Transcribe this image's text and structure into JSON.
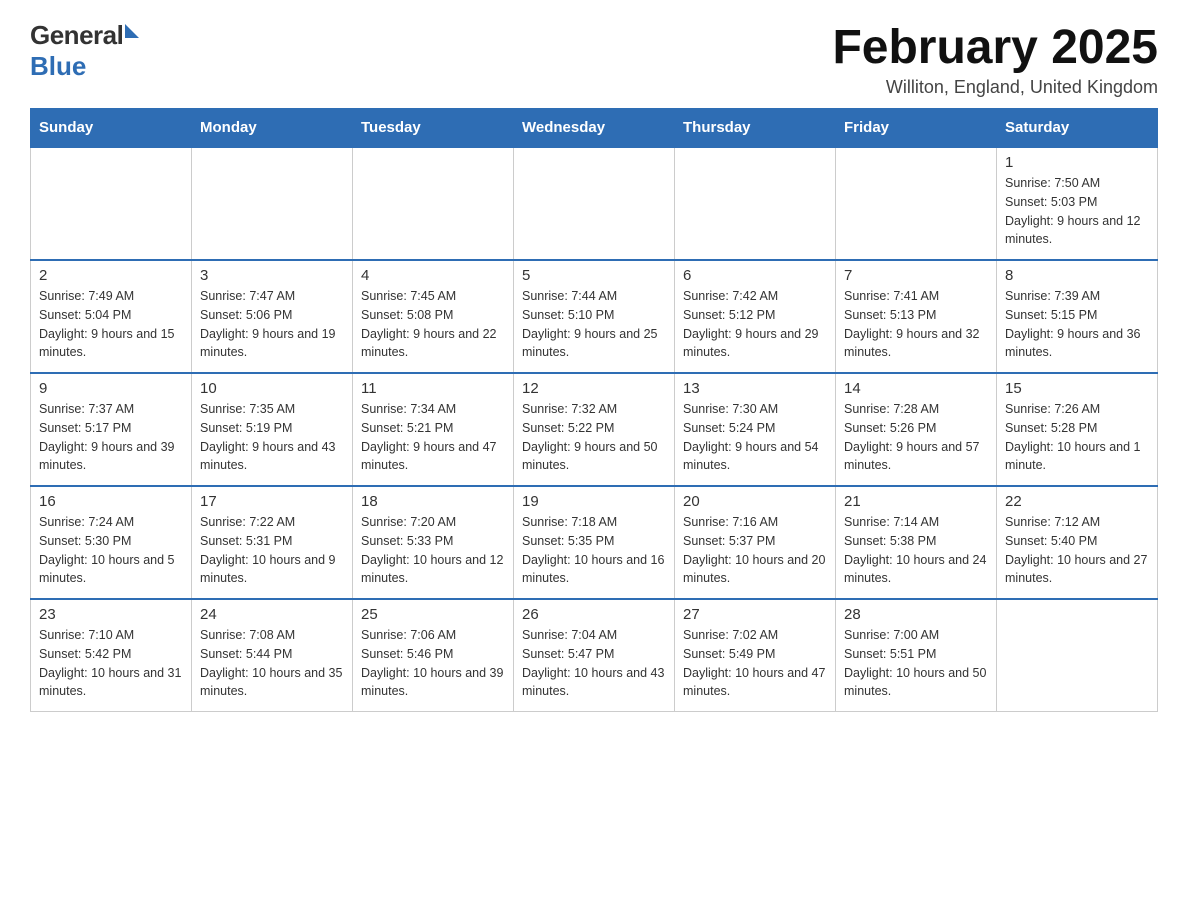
{
  "logo": {
    "general": "General",
    "blue": "Blue"
  },
  "header": {
    "month_year": "February 2025",
    "location": "Williton, England, United Kingdom"
  },
  "weekdays": [
    "Sunday",
    "Monday",
    "Tuesday",
    "Wednesday",
    "Thursday",
    "Friday",
    "Saturday"
  ],
  "weeks": [
    [
      {
        "day": "",
        "info": ""
      },
      {
        "day": "",
        "info": ""
      },
      {
        "day": "",
        "info": ""
      },
      {
        "day": "",
        "info": ""
      },
      {
        "day": "",
        "info": ""
      },
      {
        "day": "",
        "info": ""
      },
      {
        "day": "1",
        "info": "Sunrise: 7:50 AM\nSunset: 5:03 PM\nDaylight: 9 hours and 12 minutes."
      }
    ],
    [
      {
        "day": "2",
        "info": "Sunrise: 7:49 AM\nSunset: 5:04 PM\nDaylight: 9 hours and 15 minutes."
      },
      {
        "day": "3",
        "info": "Sunrise: 7:47 AM\nSunset: 5:06 PM\nDaylight: 9 hours and 19 minutes."
      },
      {
        "day": "4",
        "info": "Sunrise: 7:45 AM\nSunset: 5:08 PM\nDaylight: 9 hours and 22 minutes."
      },
      {
        "day": "5",
        "info": "Sunrise: 7:44 AM\nSunset: 5:10 PM\nDaylight: 9 hours and 25 minutes."
      },
      {
        "day": "6",
        "info": "Sunrise: 7:42 AM\nSunset: 5:12 PM\nDaylight: 9 hours and 29 minutes."
      },
      {
        "day": "7",
        "info": "Sunrise: 7:41 AM\nSunset: 5:13 PM\nDaylight: 9 hours and 32 minutes."
      },
      {
        "day": "8",
        "info": "Sunrise: 7:39 AM\nSunset: 5:15 PM\nDaylight: 9 hours and 36 minutes."
      }
    ],
    [
      {
        "day": "9",
        "info": "Sunrise: 7:37 AM\nSunset: 5:17 PM\nDaylight: 9 hours and 39 minutes."
      },
      {
        "day": "10",
        "info": "Sunrise: 7:35 AM\nSunset: 5:19 PM\nDaylight: 9 hours and 43 minutes."
      },
      {
        "day": "11",
        "info": "Sunrise: 7:34 AM\nSunset: 5:21 PM\nDaylight: 9 hours and 47 minutes."
      },
      {
        "day": "12",
        "info": "Sunrise: 7:32 AM\nSunset: 5:22 PM\nDaylight: 9 hours and 50 minutes."
      },
      {
        "day": "13",
        "info": "Sunrise: 7:30 AM\nSunset: 5:24 PM\nDaylight: 9 hours and 54 minutes."
      },
      {
        "day": "14",
        "info": "Sunrise: 7:28 AM\nSunset: 5:26 PM\nDaylight: 9 hours and 57 minutes."
      },
      {
        "day": "15",
        "info": "Sunrise: 7:26 AM\nSunset: 5:28 PM\nDaylight: 10 hours and 1 minute."
      }
    ],
    [
      {
        "day": "16",
        "info": "Sunrise: 7:24 AM\nSunset: 5:30 PM\nDaylight: 10 hours and 5 minutes."
      },
      {
        "day": "17",
        "info": "Sunrise: 7:22 AM\nSunset: 5:31 PM\nDaylight: 10 hours and 9 minutes."
      },
      {
        "day": "18",
        "info": "Sunrise: 7:20 AM\nSunset: 5:33 PM\nDaylight: 10 hours and 12 minutes."
      },
      {
        "day": "19",
        "info": "Sunrise: 7:18 AM\nSunset: 5:35 PM\nDaylight: 10 hours and 16 minutes."
      },
      {
        "day": "20",
        "info": "Sunrise: 7:16 AM\nSunset: 5:37 PM\nDaylight: 10 hours and 20 minutes."
      },
      {
        "day": "21",
        "info": "Sunrise: 7:14 AM\nSunset: 5:38 PM\nDaylight: 10 hours and 24 minutes."
      },
      {
        "day": "22",
        "info": "Sunrise: 7:12 AM\nSunset: 5:40 PM\nDaylight: 10 hours and 27 minutes."
      }
    ],
    [
      {
        "day": "23",
        "info": "Sunrise: 7:10 AM\nSunset: 5:42 PM\nDaylight: 10 hours and 31 minutes."
      },
      {
        "day": "24",
        "info": "Sunrise: 7:08 AM\nSunset: 5:44 PM\nDaylight: 10 hours and 35 minutes."
      },
      {
        "day": "25",
        "info": "Sunrise: 7:06 AM\nSunset: 5:46 PM\nDaylight: 10 hours and 39 minutes."
      },
      {
        "day": "26",
        "info": "Sunrise: 7:04 AM\nSunset: 5:47 PM\nDaylight: 10 hours and 43 minutes."
      },
      {
        "day": "27",
        "info": "Sunrise: 7:02 AM\nSunset: 5:49 PM\nDaylight: 10 hours and 47 minutes."
      },
      {
        "day": "28",
        "info": "Sunrise: 7:00 AM\nSunset: 5:51 PM\nDaylight: 10 hours and 50 minutes."
      },
      {
        "day": "",
        "info": ""
      }
    ]
  ]
}
